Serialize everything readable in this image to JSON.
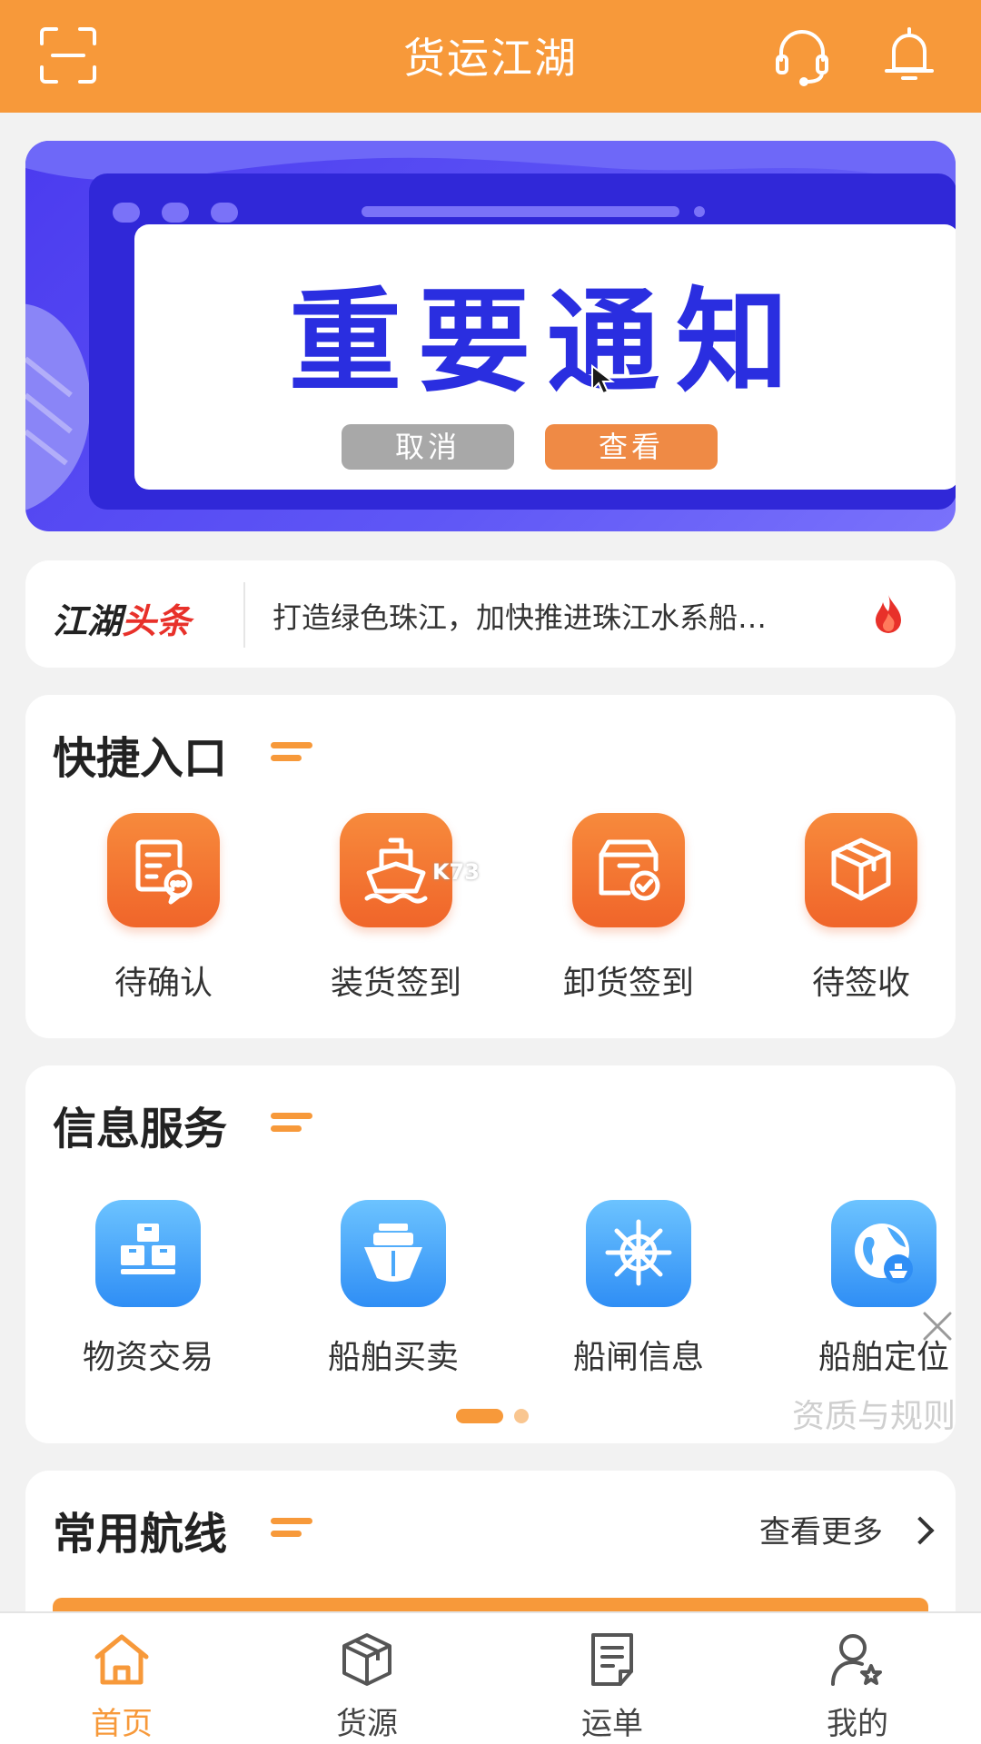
{
  "colors": {
    "primary": "#f7993a",
    "banner": "#4b3bef",
    "info_blue": "#2f8ef5",
    "fire": "#e8312a"
  },
  "header": {
    "title": "货运江湖",
    "icons": [
      "scan-icon",
      "headset-icon",
      "bell-icon"
    ]
  },
  "banner": {
    "heading": "重要通知",
    "cancel_label": "取消",
    "view_label": "查看"
  },
  "news": {
    "brand_a": "江湖",
    "brand_b": "头条",
    "headline": "打造绿色珠江，加快推进珠江水系船…",
    "icon": "fire-icon"
  },
  "quick": {
    "title": "快捷入口",
    "items": [
      {
        "label": "待确认",
        "icon": "document-chat-icon"
      },
      {
        "label": "装货签到",
        "icon": "ship-icon"
      },
      {
        "label": "卸货签到",
        "icon": "box-check-icon"
      },
      {
        "label": "待签收",
        "icon": "package-icon"
      }
    ]
  },
  "watermark": "K73",
  "info": {
    "title": "信息服务",
    "items": [
      {
        "label": "物资交易",
        "icon": "boxes-icon"
      },
      {
        "label": "船舶买卖",
        "icon": "ship-front-icon"
      },
      {
        "label": "船闸信息",
        "icon": "helm-icon"
      },
      {
        "label": "船舶定位",
        "icon": "globe-ship-icon"
      }
    ],
    "page_index": 1,
    "page_count": 2
  },
  "qualification": "资质与规则",
  "routes": {
    "title": "常用航线",
    "more_label": "查看更多"
  },
  "tabs": [
    {
      "label": "首页",
      "icon": "home-icon",
      "active": true
    },
    {
      "label": "货源",
      "icon": "cube-icon",
      "active": false
    },
    {
      "label": "运单",
      "icon": "waybill-icon",
      "active": false
    },
    {
      "label": "我的",
      "icon": "user-star-icon",
      "active": false
    }
  ]
}
